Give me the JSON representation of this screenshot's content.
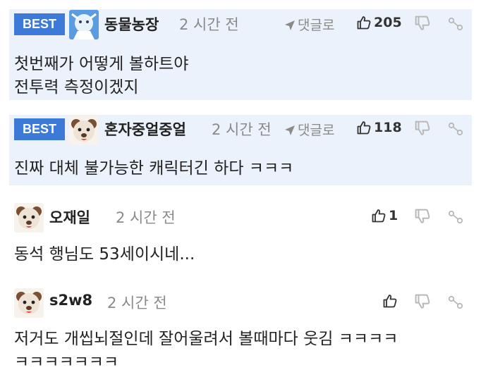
{
  "best_label": "BEST",
  "reply_label": "댓글로",
  "comments": [
    {
      "nickname": "동물농장",
      "time": "2 시간 전",
      "likes": "205",
      "lines": [
        "첫번째가 어떻게 볼하트야",
        "전투력 측정이겠지"
      ]
    },
    {
      "nickname": "혼자중얼중얼",
      "time": "2 시간 전",
      "likes": "118",
      "lines": [
        "진짜 대체 불가능한 캐릭터긴 하다 ㅋㅋㅋ"
      ]
    },
    {
      "nickname": "오재일",
      "time": "2 시간 전",
      "likes": "1",
      "lines": [
        "동석 행님도 53세이시네..."
      ]
    },
    {
      "nickname": "s2w8",
      "time": "2 시간 전",
      "likes": "",
      "lines": [
        "저거도 개씹뇌절인데 잘어울려서 볼때마다 웃김 ㅋㅋㅋㅋ",
        "ㅋㅋㅋㅋㅋㅋㅋ"
      ]
    }
  ],
  "icons": {
    "like": "thumbs-up-icon",
    "dislike": "thumbs-down-icon",
    "share": "share-icon",
    "reply": "reply-arrow-icon"
  },
  "colors": {
    "best_background": "#ecf2fb",
    "best_badge": "#3d79d6",
    "meta_gray": "#8a8a8a"
  }
}
